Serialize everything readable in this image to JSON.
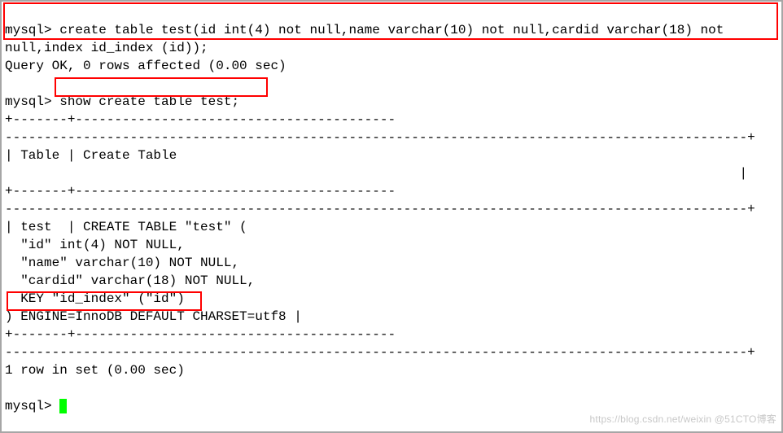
{
  "prompts": {
    "p1": "mysql>",
    "p2": "mysql>",
    "p3": "mysql>"
  },
  "commands": {
    "create_part1": " create table test(id int(4) not null,name varchar(10) not null,cardid varchar(18) not ",
    "create_part2": "null,index id_index (id));",
    "show": " show create table test;"
  },
  "responses": {
    "query_ok": "Query OK, 0 rows affected (0.00 sec)",
    "rows_in_set": "1 row in set (0.00 sec)"
  },
  "table": {
    "sep_short": "+-------+-----------------------------------------",
    "sep_long": "-----------------------------------------------------------------------------------------------+",
    "header": "| Table | Create Table                                                                           ",
    "header_end": "                                                                                              |",
    "row1": "| test  | CREATE TABLE \"test\" (",
    "row2": "  \"id\" int(4) NOT NULL,",
    "row3": "  \"name\" varchar(10) NOT NULL,",
    "row4": "  \"cardid\" varchar(18) NOT NULL,",
    "row5": "  KEY \"id_index\" (\"id\")",
    "row6": ") ENGINE=InnoDB DEFAULT CHARSET=utf8 |"
  },
  "watermark": "https://blog.csdn.net/weixin    @51CTO博客"
}
